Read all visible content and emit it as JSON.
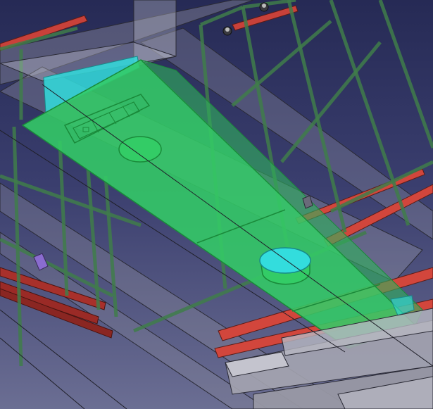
{
  "window": {
    "title": "",
    "view": "3d-model-viewport"
  },
  "scene": {
    "selected_object": "duct-panel",
    "colors": {
      "background_top": "#262a55",
      "background_bottom": "#6b6e93",
      "selection_green": "#33cc66",
      "selection_edge": "#1a8a3a",
      "cyan_highlight": "#33dddd",
      "frame_green": "#3f7d4a",
      "steel_red": "#c8413a",
      "beam_grey": "#9a9aa8"
    },
    "icons": {
      "bolt": "hex-bolt-icon",
      "bracket": "bracket-icon"
    }
  }
}
